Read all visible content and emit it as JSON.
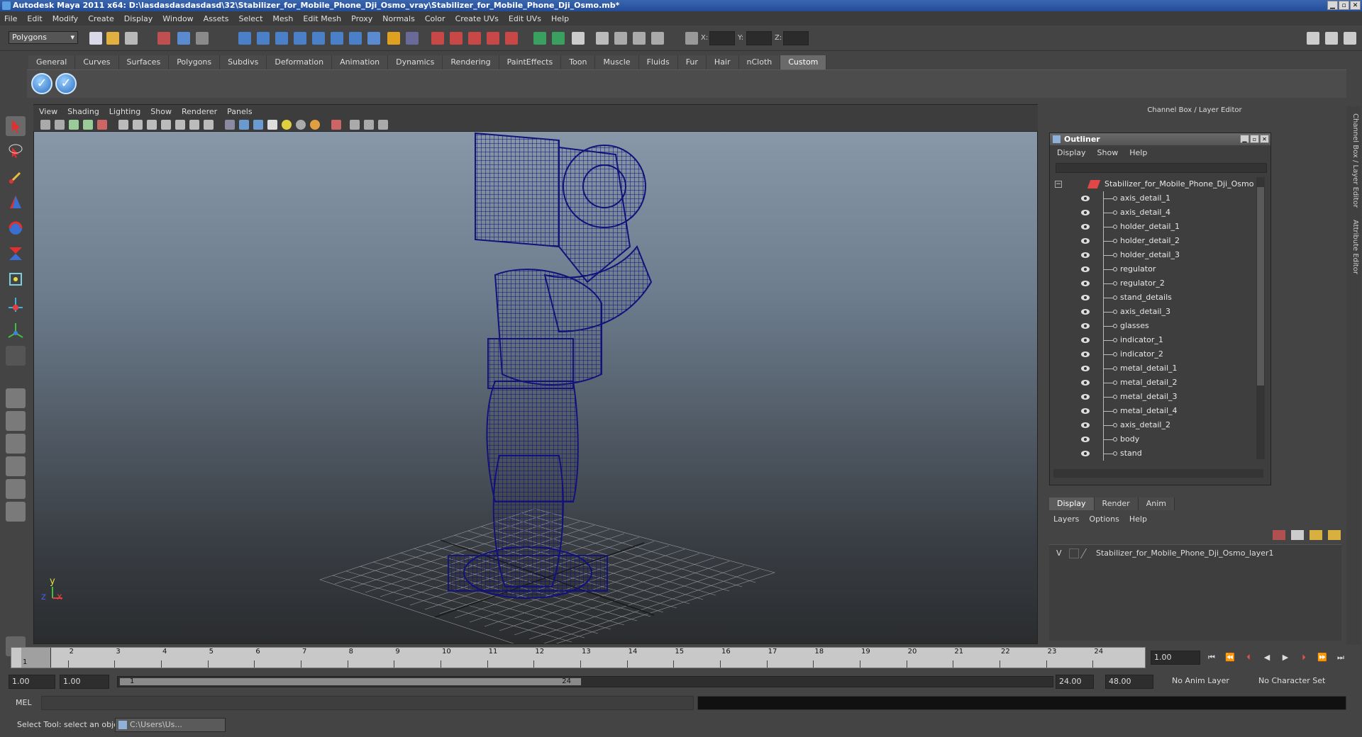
{
  "window": {
    "title": "Autodesk Maya 2011 x64: D:\\lasdasdasdasdasd\\32\\Stabilizer_for_Mobile_Phone_Dji_Osmo_vray\\Stabilizer_for_Mobile_Phone_Dji_Osmo.mb*",
    "min_label": "▁",
    "max_label": "▫",
    "close_label": "✕"
  },
  "menubar": [
    "File",
    "Edit",
    "Modify",
    "Create",
    "Display",
    "Window",
    "Assets",
    "Select",
    "Mesh",
    "Edit Mesh",
    "Proxy",
    "Normals",
    "Color",
    "Create UVs",
    "Edit UVs",
    "Help"
  ],
  "toolbar": {
    "mode": "Polygons",
    "x_label": "X:",
    "y_label": "Y:",
    "z_label": "Z:"
  },
  "shelf": {
    "tabs": [
      "General",
      "Curves",
      "Surfaces",
      "Polygons",
      "Subdivs",
      "Deformation",
      "Animation",
      "Dynamics",
      "Rendering",
      "PaintEffects",
      "Toon",
      "Muscle",
      "Fluids",
      "Fur",
      "Hair",
      "nCloth",
      "Custom"
    ],
    "active_tab": "Custom"
  },
  "viewport": {
    "menu": [
      "View",
      "Shading",
      "Lighting",
      "Show",
      "Renderer",
      "Panels"
    ],
    "axis_y": "y",
    "axis_x": "x",
    "axis_z": "z",
    "wire_color": "#12127a"
  },
  "channel_box": {
    "title": "Channel Box / Layer Editor"
  },
  "outliner": {
    "title": "Outliner",
    "menu": [
      "Display",
      "Show",
      "Help"
    ],
    "root": "Stabilizer_for_Mobile_Phone_Dji_Osmo",
    "items": [
      "axis_detail_1",
      "axis_detail_4",
      "holder_detail_1",
      "holder_detail_2",
      "holder_detail_3",
      "regulator",
      "regulator_2",
      "stand_details",
      "axis_detail_3",
      "glasses",
      "indicator_1",
      "indicator_2",
      "metal_detail_1",
      "metal_detail_2",
      "metal_detail_3",
      "metal_detail_4",
      "axis_detail_2",
      "body",
      "stand"
    ]
  },
  "layer_editor": {
    "tabs": [
      "Display",
      "Render",
      "Anim"
    ],
    "active_tab": "Display",
    "menu": [
      "Layers",
      "Options",
      "Help"
    ],
    "layer": {
      "visible": "V",
      "name": "Stabilizer_for_Mobile_Phone_Dji_Osmo_layer1"
    }
  },
  "timeline": {
    "ticks": [
      "1",
      "2",
      "3",
      "4",
      "5",
      "6",
      "7",
      "8",
      "9",
      "10",
      "11",
      "12",
      "13",
      "14",
      "15",
      "16",
      "17",
      "18",
      "19",
      "20",
      "21",
      "22",
      "23",
      "24"
    ],
    "current_frame": "1.00",
    "playhead_label": "1"
  },
  "range": {
    "start": "1.00",
    "start2": "1.00",
    "slider_start": "1",
    "slider_end": "24",
    "end": "24.00",
    "end2": "48.00",
    "anim_layer": "No Anim Layer",
    "character_set": "No Character Set"
  },
  "mel": {
    "label": "MEL"
  },
  "status": {
    "help": "Select Tool: select an object",
    "task_button": "C:\\Users\\Us..."
  },
  "side_tabs": [
    "Channel Box / Layer Editor",
    "Attribute Editor"
  ]
}
